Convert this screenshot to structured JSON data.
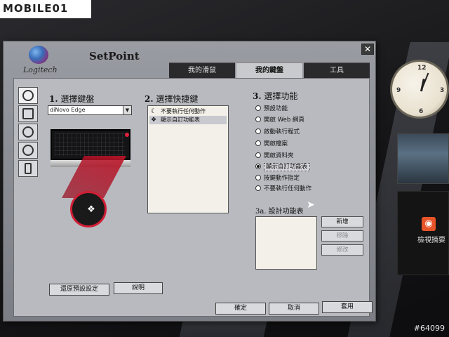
{
  "watermark": {
    "brand": "MOBILE01",
    "id": "#64099"
  },
  "desktop": {
    "rss_gadget_label": "檢視摘要"
  },
  "window": {
    "logo_text": "Logitech",
    "title": "SetPoint",
    "close_label": "✕",
    "tabs": [
      {
        "label": "我的滑鼠"
      },
      {
        "label": "我的鍵盤"
      },
      {
        "label": "工具"
      }
    ]
  },
  "section1": {
    "title_num": "1.",
    "title": "選擇鍵盤",
    "device_value": "diNovo Edge"
  },
  "section2": {
    "title_num": "2.",
    "title": "選擇快捷鍵",
    "shortcuts": [
      {
        "label": "不要執行任何動作"
      },
      {
        "label": "顯示自訂功能表"
      }
    ]
  },
  "section3": {
    "title_num": "3.",
    "title": "選擇功能",
    "options": [
      {
        "label": "預設功能"
      },
      {
        "label": "開啟 Web 網頁"
      },
      {
        "label": "啟動執行程式"
      },
      {
        "label": "開啟檔案"
      },
      {
        "label": "開啟資料夾"
      },
      {
        "label": "顯示自訂功能表"
      },
      {
        "label": "按鍵動作指定"
      },
      {
        "label": "不要執行任何動作"
      }
    ],
    "selected_index": 5
  },
  "section3a": {
    "title": "3a. 設計功能表",
    "add_label": "新增",
    "remove_label": "移除",
    "edit_label": "修改"
  },
  "footer": {
    "restore_label": "還原預設設定",
    "help_label": "說明",
    "ok_label": "確定",
    "cancel_label": "取消",
    "apply_label": "套用"
  }
}
